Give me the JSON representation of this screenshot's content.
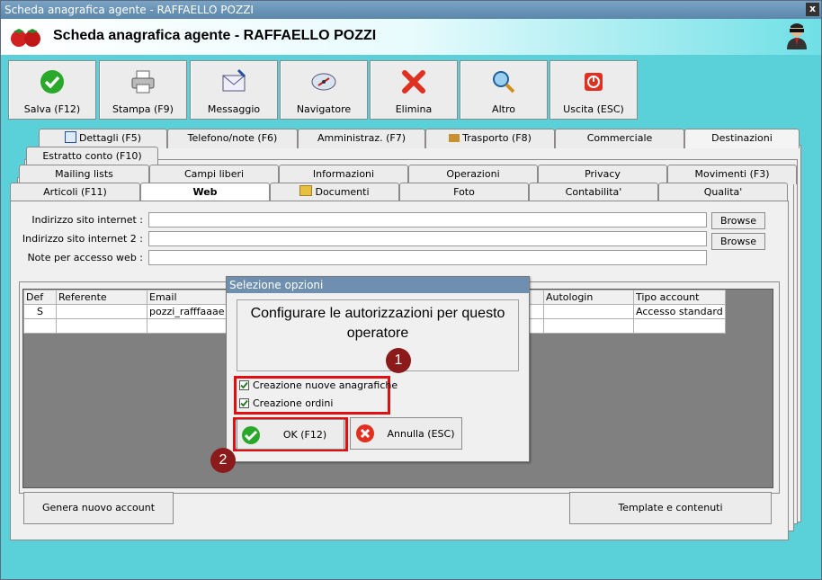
{
  "window": {
    "title": "Scheda anagrafica agente - RAFFAELLO POZZI",
    "close": "x",
    "header_title": "Scheda anagrafica agente - RAFFAELLO POZZI"
  },
  "toolbar": [
    {
      "label": "Salva (F12)",
      "icon": "check-icon"
    },
    {
      "label": "Stampa (F9)",
      "icon": "printer-icon"
    },
    {
      "label": "Messaggio",
      "icon": "envelope-icon"
    },
    {
      "label": "Navigatore",
      "icon": "compass-icon"
    },
    {
      "label": "Elimina",
      "icon": "delete-x-icon"
    },
    {
      "label": "Altro",
      "icon": "search-icon"
    },
    {
      "label": "Uscita (ESC)",
      "icon": "exit-icon"
    }
  ],
  "tabs_row1": [
    "Dettagli (F5)",
    "Telefono/note (F6)",
    "Amministraz. (F7)",
    "Trasporto (F8)",
    "Commerciale",
    "Destinazioni"
  ],
  "tabs_row1b": [
    "Estratto conto (F10)"
  ],
  "tabs_row2": [
    "Mailing lists",
    "Campi liberi",
    "Informazioni",
    "Operazioni",
    "Privacy",
    "Movimenti (F3)"
  ],
  "tabs_row3": [
    "Articoli (F11)",
    "Web",
    "Documenti",
    "Foto",
    "Contabilita'",
    "Qualita'"
  ],
  "form": {
    "site_label": "Indirizzo sito internet :",
    "site2_label": "Indirizzo sito internet 2 :",
    "notes_label": "Note per accesso web :",
    "browse1": "Browse",
    "browse2": "Browse"
  },
  "grid": {
    "headers": [
      "Def",
      "Referente",
      "Email",
      "Autologin",
      "Tipo account"
    ],
    "rows": [
      {
        "def": "S",
        "referente": "",
        "email": "pozzi_rafffaaae",
        "autologin": "",
        "tipo": "Accesso standard"
      }
    ]
  },
  "buttons": {
    "new_account": "Genera nuovo account",
    "templates": "Template e contenuti"
  },
  "dialog": {
    "title": "Selezione opzioni",
    "message": "Configurare le autorizzazioni per questo operatore",
    "options": [
      {
        "label": "Creazione nuove anagrafiche",
        "checked": true
      },
      {
        "label": "Creazione ordini",
        "checked": true
      }
    ],
    "ok": "OK (F12)",
    "cancel": "Annulla (ESC)"
  },
  "markers": [
    "1",
    "2"
  ],
  "colors": {
    "window_bg": "#5ad0d8",
    "highlight": "#e01010",
    "marker": "#8b1a1a",
    "dialog_title": "#6f8fb0"
  }
}
